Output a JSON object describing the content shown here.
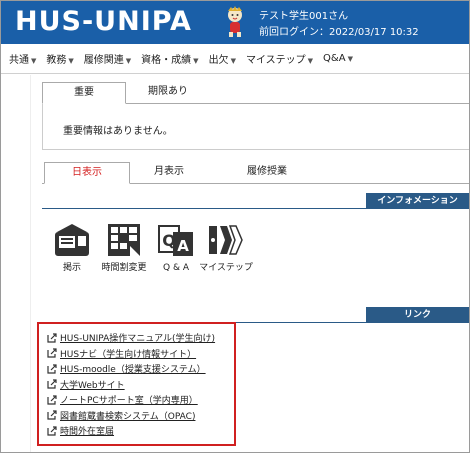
{
  "header": {
    "logo": "HUS-UNIPA",
    "user_name": "テスト学生001さん",
    "last_login": "前回ログイン：2022/03/17 10:32",
    "colors": {
      "header_bg": "#1a5fa8",
      "section_bg": "#2a5a87",
      "active_tab": "#d42020",
      "highlight_box": "#d02020"
    }
  },
  "menu": [
    {
      "label": "共通"
    },
    {
      "label": "教務"
    },
    {
      "label": "履修関連"
    },
    {
      "label": "資格・成績"
    },
    {
      "label": "出欠"
    },
    {
      "label": "マイステップ"
    },
    {
      "label": "Q&A"
    }
  ],
  "notice_tabs": {
    "tabs": [
      {
        "label": "重要"
      },
      {
        "label": "期限あり"
      }
    ],
    "message": "重要情報はありません。"
  },
  "view_tabs": [
    {
      "label": "日表示"
    },
    {
      "label": "月表示"
    },
    {
      "label": "履修授業"
    }
  ],
  "info_section": {
    "title": "インフォメーション",
    "icons": [
      {
        "label": "掲示",
        "icon": "bulletin-icon"
      },
      {
        "label": "時間割変更",
        "icon": "timetable-change-icon"
      },
      {
        "label": "Q & A",
        "icon": "qa-icon"
      },
      {
        "label": "マイステップ",
        "icon": "mystep-icon"
      }
    ]
  },
  "link_section": {
    "title": "リンク",
    "links": [
      {
        "label": "HUS-UNIPA操作マニュアル(学生向け)"
      },
      {
        "label": "HUSナビ（学生向け情報サイト）"
      },
      {
        "label": "HUS-moodle（授業支援システム）"
      },
      {
        "label": "大学Webサイト"
      },
      {
        "label": "ノートPCサポート室（学内専用）"
      },
      {
        "label": "図書館蔵書検索システム（OPAC)"
      },
      {
        "label": "時間外在室届"
      }
    ]
  }
}
